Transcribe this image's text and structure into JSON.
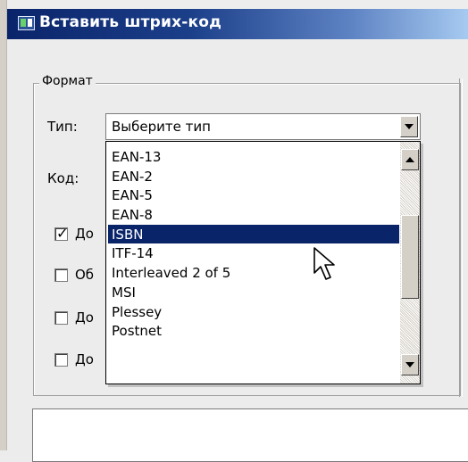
{
  "window": {
    "title": "Вставить штрих-код"
  },
  "format_group": {
    "title": "Формат",
    "type_label": "Тип:",
    "code_label": "Код:",
    "type_combo": {
      "value": "Выберите тип"
    },
    "checkboxes": [
      {
        "label_fragment": "До",
        "checked": true
      },
      {
        "label_fragment": "Об",
        "checked": false
      },
      {
        "label_fragment": "До",
        "checked": false
      },
      {
        "label_fragment": "До",
        "checked": false
      }
    ]
  },
  "dropdown": {
    "items": [
      "EAN-13",
      "EAN-2",
      "EAN-5",
      "EAN-8",
      "ISBN",
      "ITF-14",
      "Interleaved 2 of 5",
      "MSI",
      "Plessey",
      "Postnet"
    ],
    "selected": "ISBN"
  },
  "colors": {
    "selection": "#0a246a",
    "title_gradient_start": "#0a246a",
    "title_gradient_end": "#a6caf0"
  },
  "icons": {
    "title_icon": "app-barcode-icon",
    "cursor": "arrow-pointer-icon"
  }
}
